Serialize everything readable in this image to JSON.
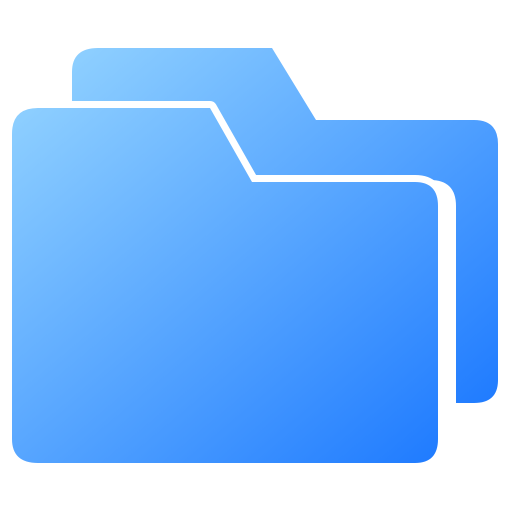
{
  "icon": {
    "name": "folders-icon",
    "colors": {
      "gradient_start": "#8fd0ff",
      "gradient_end": "#1f7bff",
      "separator": "#ffffff",
      "background": "#ffffff"
    }
  }
}
